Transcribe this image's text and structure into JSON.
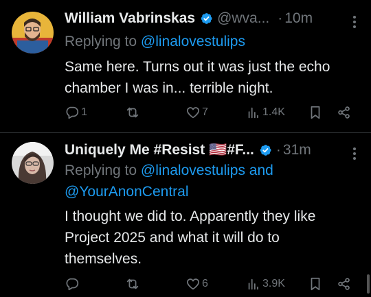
{
  "tweets": [
    {
      "author": "William Vabrinskas",
      "handle": "@wva...",
      "dot": "·",
      "time": "10m",
      "replying_prefix": "Replying to ",
      "replying_to": "@linalovestulips",
      "replying_and": "",
      "replying_to_2": "",
      "text": "Same here. Turns out it was just the echo chamber I was in... terrible night.",
      "replies": "1",
      "reposts": "",
      "likes": "7",
      "views": "1.4K"
    },
    {
      "author": "Uniquely Me #Resist 🇺🇸#F...",
      "handle": "",
      "dot": "·",
      "time": "31m",
      "replying_prefix": "Replying to ",
      "replying_to": "@linalovestulips",
      "replying_and": " and",
      "replying_to_2": "@YourAnonCentral",
      "text": "I thought we did to. Apparently they like Project 2025 and what it will do to themselves.",
      "replies": "",
      "reposts": "",
      "likes": "6",
      "views": "3.9K"
    }
  ],
  "colors": {
    "background": "#000000",
    "text": "#e7e9ea",
    "muted": "#71767b",
    "accent": "#1d9bf0",
    "divider": "#2f3336"
  },
  "icons": [
    "verified-badge-icon",
    "more-icon",
    "reply-icon",
    "repost-icon",
    "like-icon",
    "views-icon",
    "bookmark-icon",
    "share-icon"
  ]
}
